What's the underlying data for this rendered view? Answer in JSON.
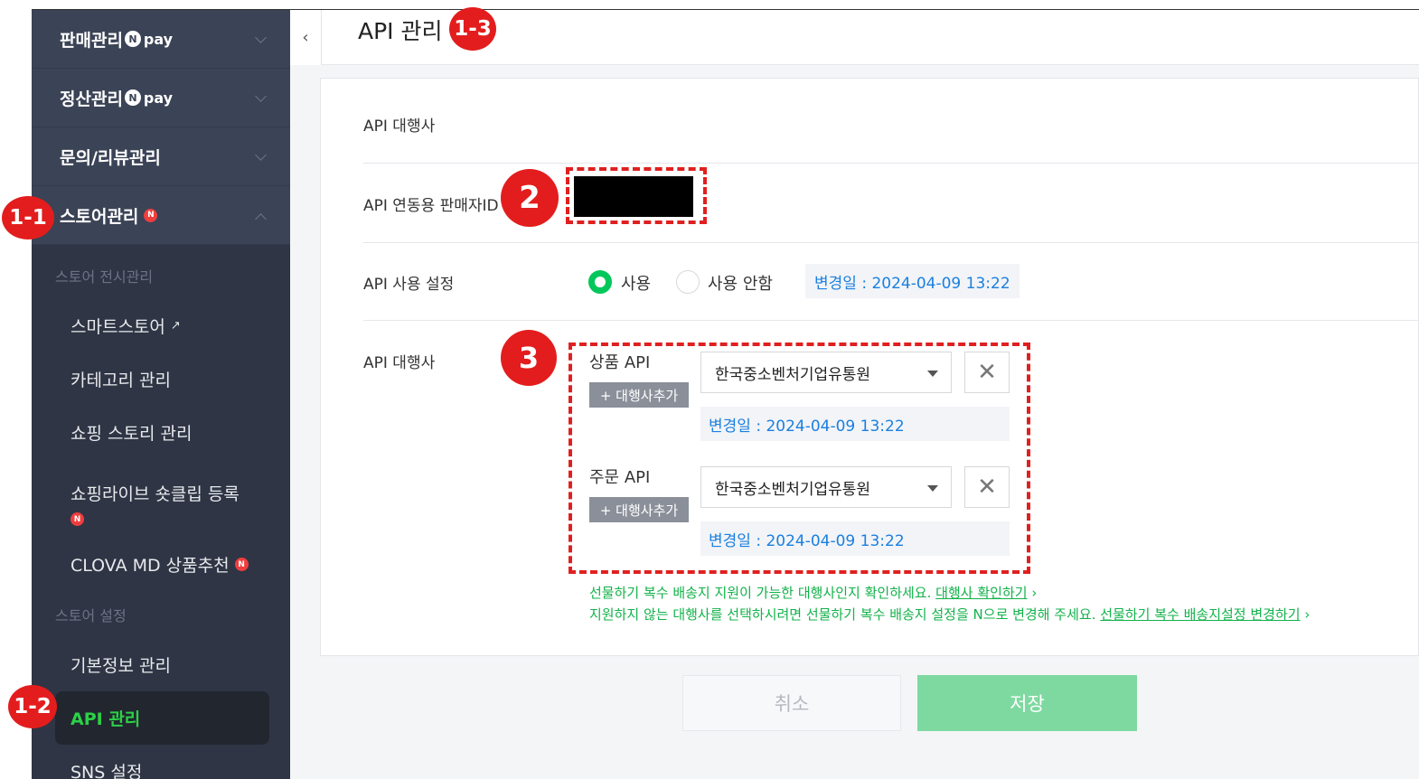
{
  "sidebar": {
    "menu": [
      {
        "label": "판매관리",
        "pay": "pay",
        "npay_letter": "N"
      },
      {
        "label": "정산관리",
        "pay": "pay",
        "npay_letter": "N"
      },
      {
        "label": "문의/리뷰관리"
      },
      {
        "label": "스토어관리",
        "badge": "N"
      }
    ],
    "group_display": "스토어 전시관리",
    "display_items": [
      {
        "label": "스마트스토어",
        "ext": "↗"
      },
      {
        "label": "카테고리 관리"
      },
      {
        "label": "쇼핑 스토리 관리"
      },
      {
        "label": "쇼핑라이브 숏클립 등록",
        "badge": "N"
      },
      {
        "label": "CLOVA MD 상품추천",
        "badge": "N"
      }
    ],
    "group_settings": "스토어 설정",
    "settings_items": [
      {
        "label": "기본정보 관리"
      },
      {
        "label": "API 관리"
      },
      {
        "label": "SNS 설정"
      }
    ]
  },
  "header": {
    "collapse": "‹",
    "title": "API 관리"
  },
  "form": {
    "agency_label": "API 대행사",
    "seller_id_label": "API 연동용 판매자ID",
    "usage_label": "API 사용 설정",
    "usage_on": "사용",
    "usage_off": "사용 안함",
    "usage_changed": "변경일 : 2024-04-09 13:22",
    "agency_label2": "API 대행사",
    "product_api": {
      "label": "상품 API",
      "add": "+ 대행사추가",
      "selected": "한국중소벤처기업유통원",
      "changed": "변경일 : 2024-04-09 13:22"
    },
    "order_api": {
      "label": "주문 API",
      "add": "+ 대행사추가",
      "selected": "한국중소벤처기업유통원",
      "changed": "변경일 : 2024-04-09 13:22"
    },
    "note1": "선물하기 복수 배송지 지원이 가능한 대행사인지 확인하세요.",
    "note1_link": "대행사 확인하기",
    "note2": "지원하지 않는 대행사를 선택하시려면 선물하기 복수 배송지 설정을 N으로 변경해 주세요.",
    "note2_link": "선물하기 복수 배송지설정 변경하기",
    "link_arrow": "›",
    "remove": "✕"
  },
  "buttons": {
    "cancel": "취소",
    "save": "저장"
  },
  "annotations": {
    "m11": "1-1",
    "m12": "1-2",
    "m13": "1-3",
    "m2": "2",
    "m3": "3"
  },
  "colors": {
    "sidebar_bg": "#3b4356",
    "submenu_bg": "#2f3545",
    "active_green": "#2bd147",
    "radio_green": "#03c75a",
    "date_blue": "#1b7fe0",
    "note_green": "#13b24a",
    "save_bg": "#7ed9a0",
    "annotation_red": "#e02020"
  }
}
